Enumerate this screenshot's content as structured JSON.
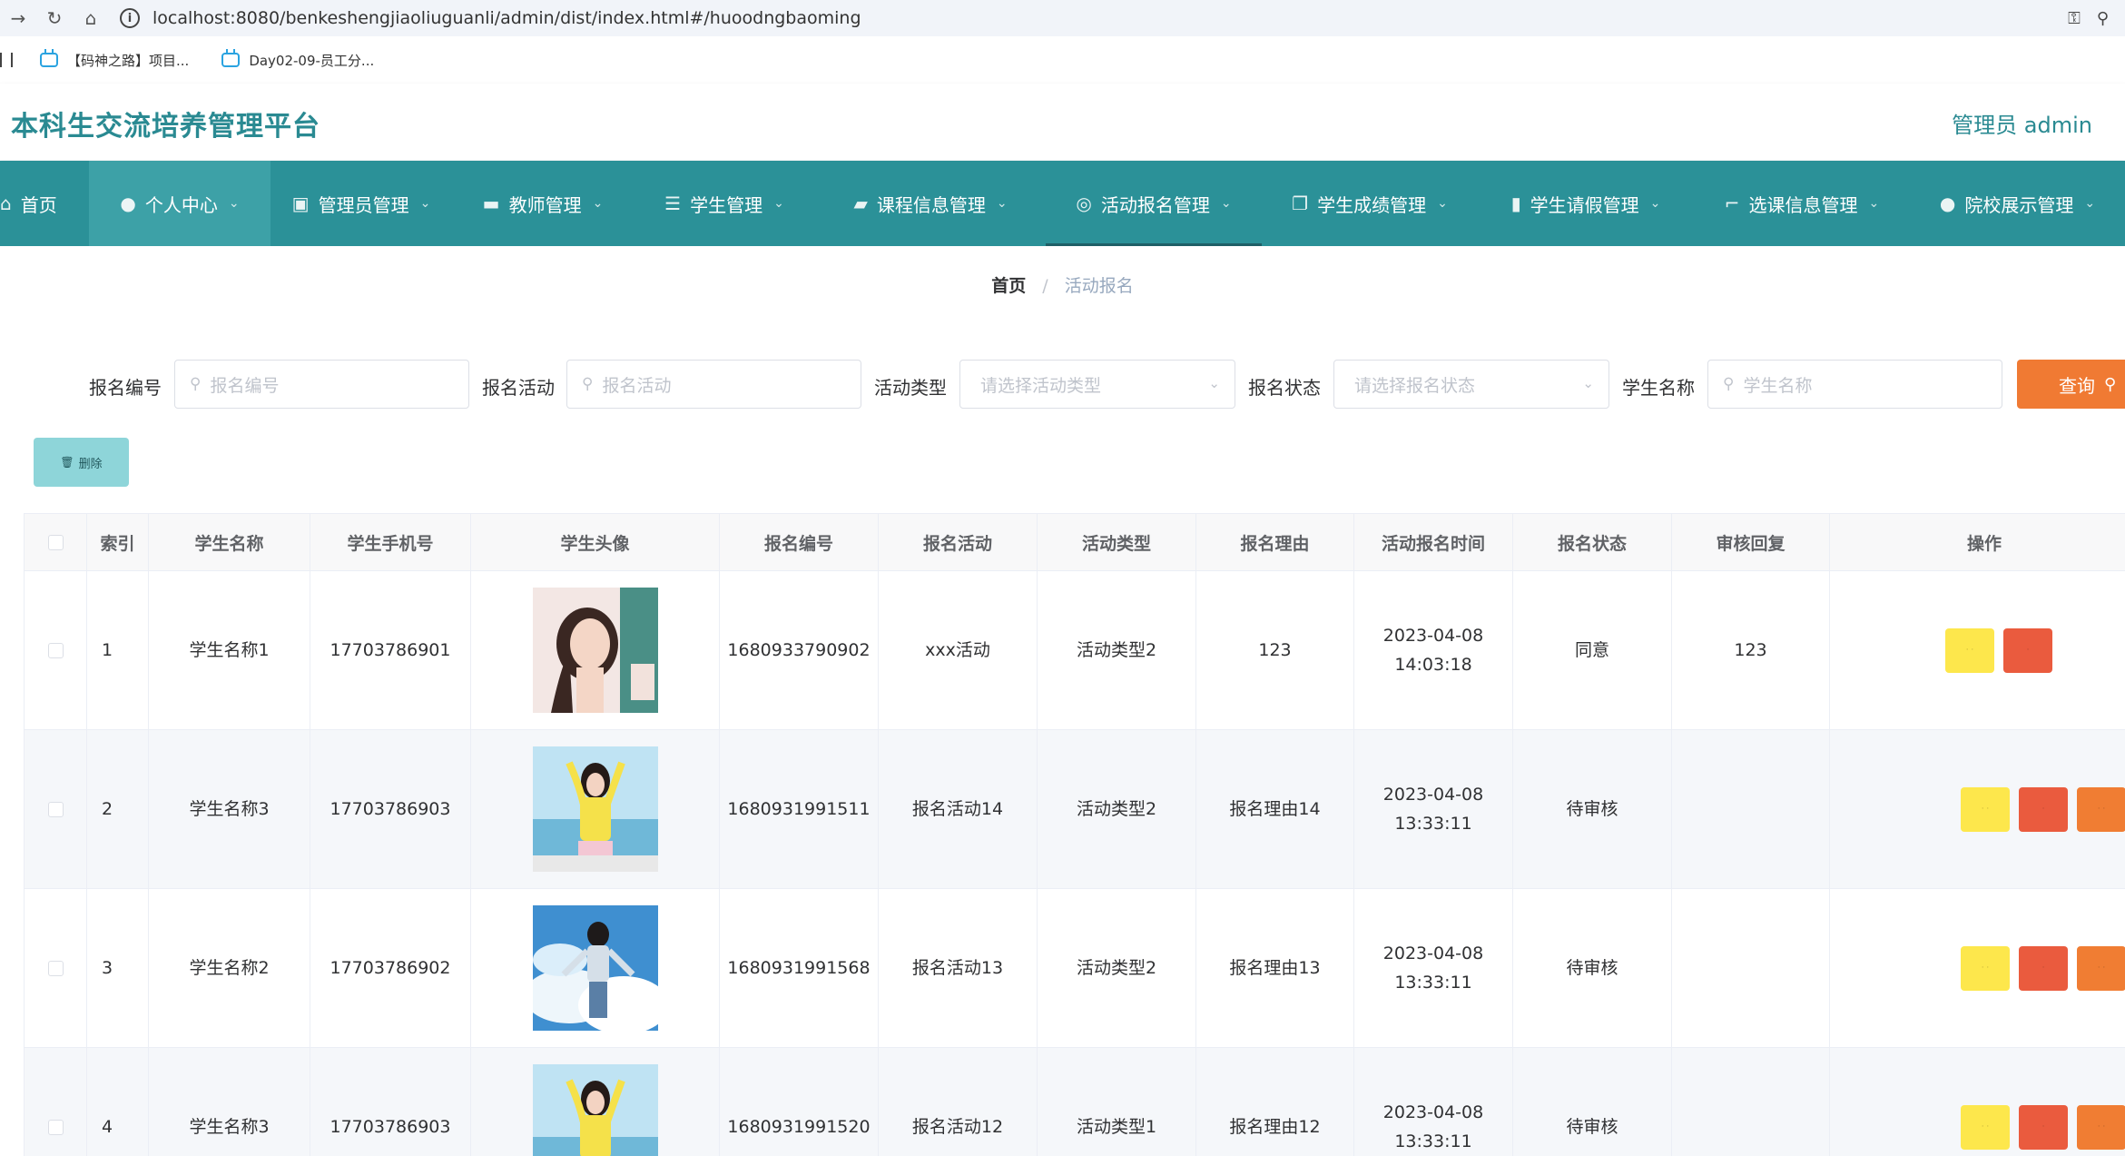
{
  "browser": {
    "url": "localhost:8080/benkeshengjiaoliuguanli/admin/dist/index.html#/huoodngbaoming",
    "bookmarks": [
      {
        "label": "【码神之路】项目..."
      },
      {
        "label": "Day02-09-员工分..."
      }
    ]
  },
  "header": {
    "title": "本科生交流培养管理平台",
    "user": "管理员 admin"
  },
  "nav": {
    "items": [
      {
        "label": "首页",
        "icon": "home-icon"
      },
      {
        "label": "个人中心",
        "icon": "user-icon"
      },
      {
        "label": "管理员管理",
        "icon": "clipboard-icon"
      },
      {
        "label": "教师管理",
        "icon": "chat-icon"
      },
      {
        "label": "学生管理",
        "icon": "sliders-icon"
      },
      {
        "label": "课程信息管理",
        "icon": "wallet-icon"
      },
      {
        "label": "活动报名管理",
        "icon": "compass-icon"
      },
      {
        "label": "学生成绩管理",
        "icon": "copy-icon"
      },
      {
        "label": "学生请假管理",
        "icon": "notebook-icon"
      },
      {
        "label": "选课信息管理",
        "icon": "crop-icon"
      },
      {
        "label": "院校展示管理",
        "icon": "location-icon"
      }
    ]
  },
  "breadcrumb": {
    "home": "首页",
    "separator": "/",
    "current": "活动报名"
  },
  "search": {
    "fields": [
      {
        "label": "报名编号",
        "placeholder": "报名编号"
      },
      {
        "label": "报名活动",
        "placeholder": "报名活动"
      },
      {
        "label": "活动类型",
        "placeholder": "请选择活动类型"
      },
      {
        "label": "报名状态",
        "placeholder": "请选择报名状态"
      },
      {
        "label": "学生名称",
        "placeholder": "学生名称"
      }
    ],
    "button": "查询"
  },
  "actions": {
    "delete": "删除"
  },
  "table": {
    "columns": [
      "索引",
      "学生名称",
      "学生手机号",
      "学生头像",
      "报名编号",
      "报名活动",
      "活动类型",
      "报名理由",
      "活动报名时间",
      "报名状态",
      "审核回复",
      "操作"
    ],
    "rows": [
      {
        "index": "1",
        "name": "学生名称1",
        "phone": "17703786901",
        "code": "1680933790902",
        "activity": "xxx活动",
        "type": "活动类型2",
        "reason": "123",
        "time": "2023-04-08 14:03:18",
        "status": "同意",
        "reply": "123"
      },
      {
        "index": "2",
        "name": "学生名称3",
        "phone": "17703786903",
        "code": "1680931991511",
        "activity": "报名活动14",
        "type": "活动类型2",
        "reason": "报名理由14",
        "time": "2023-04-08 13:33:11",
        "status": "待审核",
        "reply": ""
      },
      {
        "index": "3",
        "name": "学生名称2",
        "phone": "17703786902",
        "code": "1680931991568",
        "activity": "报名活动13",
        "type": "活动类型2",
        "reason": "报名理由13",
        "time": "2023-04-08 13:33:11",
        "status": "待审核",
        "reply": ""
      },
      {
        "index": "4",
        "name": "学生名称3",
        "phone": "17703786903",
        "code": "1680931991520",
        "activity": "报名活动12",
        "type": "活动类型1",
        "reason": "报名理由12",
        "time": "2023-04-08 13:33:11",
        "status": "待审核",
        "reply": ""
      }
    ]
  },
  "colors": {
    "brand": "#2b9198",
    "title": "#2a8a92",
    "search_button": "#f07a33",
    "delete_button": "#8ed5d9",
    "op_yellow": "#fde74c",
    "op_red": "#ea5b3e",
    "op_orange": "#f07d33"
  }
}
